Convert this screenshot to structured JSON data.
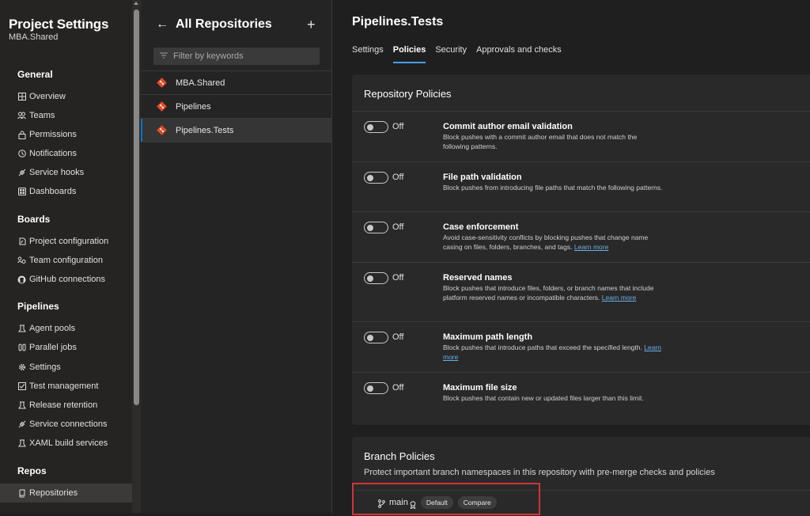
{
  "nav": {
    "title": "Project Settings",
    "subtitle": "MBA.Shared",
    "sections": [
      {
        "label": "General",
        "items": [
          {
            "label": "Overview",
            "icon": "overview-icon"
          },
          {
            "label": "Teams",
            "icon": "teams-icon"
          },
          {
            "label": "Permissions",
            "icon": "permissions-lock-icon"
          },
          {
            "label": "Notifications",
            "icon": "notifications-icon"
          },
          {
            "label": "Service hooks",
            "icon": "service-hooks-icon"
          },
          {
            "label": "Dashboards",
            "icon": "dashboards-icon"
          }
        ]
      },
      {
        "label": "Boards",
        "items": [
          {
            "label": "Project configuration",
            "icon": "project-config-icon"
          },
          {
            "label": "Team configuration",
            "icon": "team-config-icon"
          },
          {
            "label": "GitHub connections",
            "icon": "github-icon"
          }
        ]
      },
      {
        "label": "Pipelines",
        "items": [
          {
            "label": "Agent pools",
            "icon": "agent-pools-icon"
          },
          {
            "label": "Parallel jobs",
            "icon": "parallel-jobs-icon"
          },
          {
            "label": "Settings",
            "icon": "gear-icon"
          },
          {
            "label": "Test management",
            "icon": "test-management-icon"
          },
          {
            "label": "Release retention",
            "icon": "release-retention-icon"
          },
          {
            "label": "Service connections",
            "icon": "service-connections-icon"
          },
          {
            "label": "XAML build services",
            "icon": "xaml-build-icon"
          }
        ]
      },
      {
        "label": "Repos",
        "items": [
          {
            "label": "Repositories",
            "icon": "repositories-icon",
            "selected": true
          }
        ]
      }
    ]
  },
  "repo_pane": {
    "title": "All Repositories",
    "filter_placeholder": "Filter by keywords",
    "repos": [
      {
        "name": "MBA.Shared"
      },
      {
        "name": "Pipelines"
      },
      {
        "name": "Pipelines.Tests",
        "selected": true
      }
    ]
  },
  "main": {
    "title": "Pipelines.Tests",
    "tabs": [
      {
        "label": "Settings"
      },
      {
        "label": "Policies",
        "active": true
      },
      {
        "label": "Security"
      },
      {
        "label": "Approvals and checks"
      }
    ],
    "repository_policies": {
      "title": "Repository Policies",
      "policies": [
        {
          "toggle": "Off",
          "title": "Commit author email validation",
          "desc": "Block pushes with a commit author email that does not match the following patterns."
        },
        {
          "toggle": "Off",
          "title": "File path validation",
          "desc": "Block pushes from introducing file paths that match the following patterns."
        },
        {
          "toggle": "Off",
          "title": "Case enforcement",
          "desc": "Avoid case-sensitivity conflicts by blocking pushes that change name casing on files, folders, branches, and tags.",
          "link": "Learn more"
        },
        {
          "toggle": "Off",
          "title": "Reserved names",
          "desc": "Block pushes that introduce files, folders, or branch names that include platform reserved names or incompatible characters.",
          "link": "Learn more"
        },
        {
          "toggle": "Off",
          "title": "Maximum path length",
          "desc": "Block pushes that introduce paths that exceed the specified length.",
          "link": "Learn more"
        },
        {
          "toggle": "Off",
          "title": "Maximum file size",
          "desc": "Block pushes that contain new or updated files larger than this limit."
        }
      ]
    },
    "branch_policies": {
      "title": "Branch Policies",
      "subtitle": "Protect important branch namespaces in this repository with pre-merge checks and policies",
      "branch": "main",
      "badges": [
        "Default",
        "Compare"
      ]
    }
  },
  "colors": {
    "accent": "#479ef5",
    "link": "#69afe5",
    "git_red": "#e34c26",
    "highlight_red": "#d13438"
  }
}
